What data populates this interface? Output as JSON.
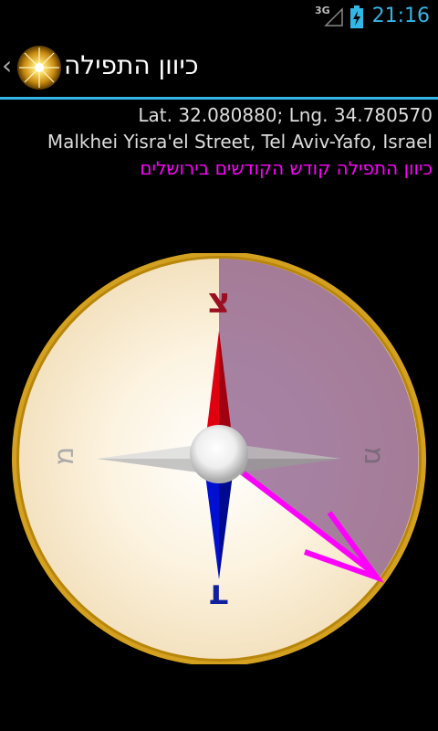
{
  "status_bar": {
    "network_type": "3G",
    "time": "21:16"
  },
  "action_bar": {
    "back_glyph": "‹",
    "title": "כיוון התפילה"
  },
  "location": {
    "coordinates": "Lat. 32.080880; Lng. 34.780570",
    "address": "Malkhei Yisra'el Street, Tel Aviv-Yafo, Israel",
    "prayer_direction": "כיוון התפילה קודש הקודשים בירושלים"
  },
  "compass": {
    "north_label": "צ",
    "south_label": "ד",
    "east_label": "מ",
    "west_label": "מ",
    "colors": {
      "north_needle": "#e00010",
      "south_needle": "#0010d0",
      "prayer_arrow": "#ff00ff",
      "rim": "#d4a020"
    }
  }
}
